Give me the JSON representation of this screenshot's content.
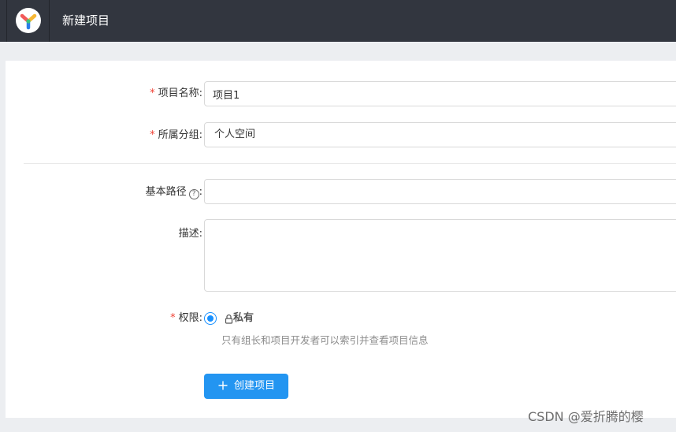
{
  "header": {
    "title": "新建项目",
    "logo_icon": "yapi-logo",
    "bar_color": "#32363f"
  },
  "form": {
    "required_mark": "*",
    "name": {
      "label": "项目名称:",
      "value": "项目1"
    },
    "group": {
      "label": "所属分组:",
      "value": "个人空间"
    },
    "base_path": {
      "label": "基本路径",
      "help_icon": "?",
      "colon": ":",
      "value": ""
    },
    "description": {
      "label": "描述:",
      "value": ""
    },
    "permission": {
      "label": "权限:",
      "option_label": "私有",
      "option_icon": "lock-icon",
      "selected": true,
      "description": "只有组长和项目开发者可以索引并查看项目信息"
    },
    "submit": {
      "icon": "+",
      "label": "创建项目",
      "color": "#2395f1"
    }
  },
  "watermark": "CSDN @爱折腾的樱"
}
